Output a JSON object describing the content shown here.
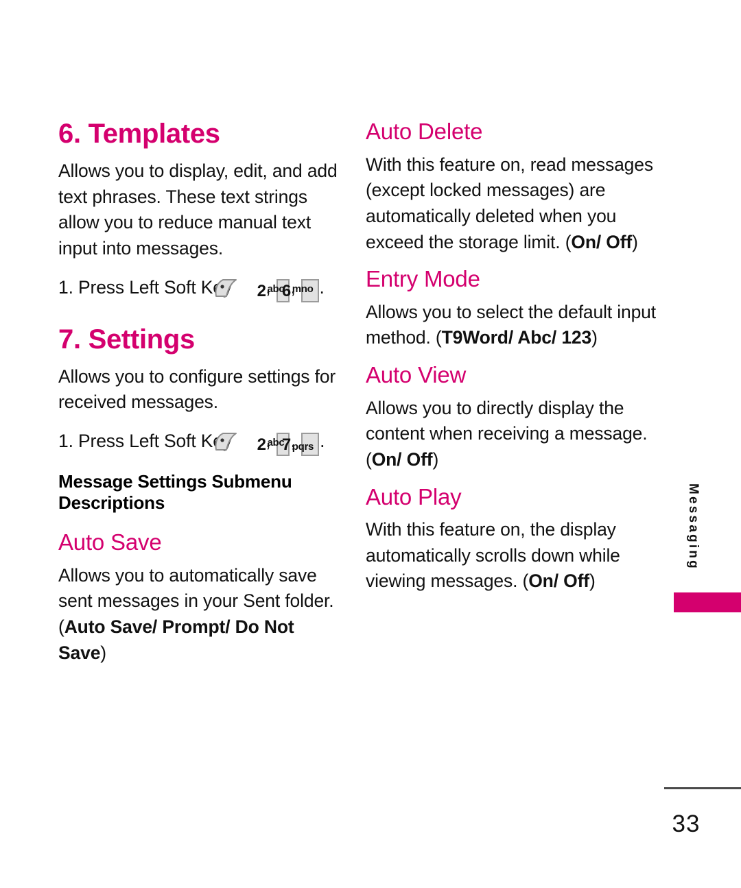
{
  "page": {
    "number": "33",
    "side_tab_label": "Messaging",
    "accent_color": "#D4006E"
  },
  "icons": {
    "left_soft_key": "left-soft-key-icon"
  },
  "keys": {
    "two": {
      "digit": "2",
      "letters": "abc"
    },
    "six": {
      "digit": "6",
      "letters": "mno"
    },
    "seven": {
      "digit": "7",
      "letters": "pqrs"
    }
  },
  "left_column": {
    "chapter_6": {
      "title": "6. Templates",
      "body": "Allows you to display, edit, and add text phrases. These text strings allow you to reduce manual text input into messages.",
      "step_prefix": "1. Press Left Soft Key",
      "comma_1": ",",
      "comma_2": ",",
      "period": "."
    },
    "chapter_7": {
      "title": "7. Settings",
      "body": "Allows you to configure settings for received messages.",
      "step_prefix": "1. Press Left Soft Key",
      "comma_1": ",",
      "comma_2": ",",
      "period": "."
    },
    "submenu_heading": "Message Settings Submenu Descriptions",
    "auto_save": {
      "title": "Auto Save",
      "body_plain": "Allows you to automatically save sent messages in your Sent folder. (",
      "body_bold": "Auto Save/ Prompt/ Do Not Save",
      "body_tail": ")"
    }
  },
  "right_column": {
    "auto_delete": {
      "title": "Auto Delete",
      "body_plain": "With this feature on, read messages (except locked messages) are automatically deleted when you exceed the storage limit. (",
      "body_bold": "On/ Off",
      "body_tail": ")"
    },
    "entry_mode": {
      "title": "Entry Mode",
      "body_plain": "Allows you to select the default input method. (",
      "body_bold": "T9Word/ Abc/ 123",
      "body_tail": ")"
    },
    "auto_view": {
      "title": "Auto View",
      "body_plain": "Allows you to directly display the content when receiving a message. (",
      "body_bold": "On/ Off",
      "body_tail": ")"
    },
    "auto_play": {
      "title": "Auto Play",
      "body_plain": "With this feature on, the display automatically scrolls down while viewing messages. (",
      "body_bold": "On/ Off",
      "body_tail": ")"
    }
  }
}
